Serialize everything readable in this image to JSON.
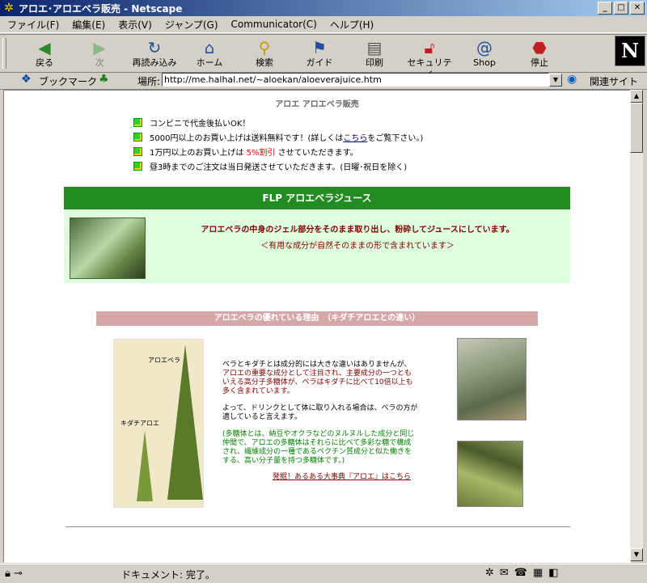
{
  "window": {
    "title": "アロエ･アロエベラ販売 - Netscape",
    "buttons": {
      "minimize": "_",
      "maximize": "□",
      "close": "✕"
    }
  },
  "menu": [
    "ファイル(F)",
    "編集(E)",
    "表示(V)",
    "ジャンプ(G)",
    "Communicator(C)",
    "ヘルプ(H)"
  ],
  "toolbar": {
    "buttons": [
      {
        "label": "戻る",
        "icon": "back-arrow-icon"
      },
      {
        "label": "次",
        "icon": "forward-arrow-icon"
      },
      {
        "label": "再読み込み",
        "icon": "reload-icon"
      },
      {
        "label": "ホーム",
        "icon": "home-icon"
      },
      {
        "label": "検索",
        "icon": "search-icon"
      },
      {
        "label": "ガイド",
        "icon": "guide-icon"
      },
      {
        "label": "印刷",
        "icon": "print-icon"
      },
      {
        "label": "セキュリティ",
        "icon": "lock-icon"
      },
      {
        "label": "Shop",
        "icon": "shop-icon"
      },
      {
        "label": "停止",
        "icon": "stop-icon"
      }
    ],
    "logo": "N"
  },
  "location": {
    "bookmark_label": "ブックマーク",
    "location_label": "場所:",
    "url": "http://me.halhal.net/~aloekan/aloeverajuice.htm",
    "related_label": "関連サイト"
  },
  "page": {
    "title": "アロエ アロエベラ販売",
    "notices": {
      "n1": "コンビニで代金後払いOK！",
      "n2_pre": "5000円以上のお買い上げは送料無料です！(詳しくは",
      "n2_link": "こちら",
      "n2_post": "をご覧下さい。)",
      "n3_pre": "1万円以上のお買い上げは",
      "n3_red": "5%割引",
      "n3_post": "させていただきます。",
      "n4": "昼3時までのご注文は当日発送させていただきます。(日曜･祝日を除く)"
    },
    "product": {
      "heading": "FLP アロエベラジュース",
      "description": "アロエベラの中身のジェル部分をそのまま取り出し、粉砕してジュースにしています。",
      "subtext": "＜有用な成分が自然そのままの形で含まれています＞"
    },
    "reason": {
      "heading": "アロエベラの優れている理由　（キダチアロエとの違い）",
      "diagram_label_aloevera": "アロエベラ",
      "diagram_label_kidachi": "キダチアロエ",
      "p1_a": "ベラとキダチとは成分的には大きな違いはありませんが、",
      "p1_b": "アロエの重要な成分として注目され、主要成分の一つともいえる高分子多糖体が、ベラはキダチに比べて10倍以上も多く含まれています。",
      "p2": "よって、ドリンクとして体に取り入れる場合は、ベラの方が適していると言えます。",
      "p3": "(多糖体とは、納豆やオクラなどのヌルヌルした成分と同じ仲間で、アロエの多糖体はそれらに比べて多彩な糖で構成され、繊維成分の一種であるペクチン質成分と似た働きをする、高い分子量を持つ多糖体です。)",
      "link": "発掘！あるある大事典『アロエ』はこちら"
    }
  },
  "status": {
    "text": "ドキュメント: 完了。"
  }
}
